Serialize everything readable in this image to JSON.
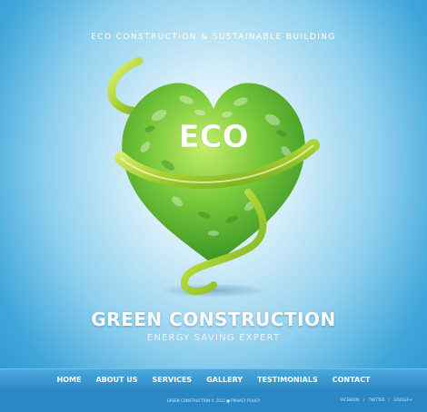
{
  "header": {
    "tagline": "ECO CONSTRUCTION & SUSTAINABLE BUILDING"
  },
  "hero": {
    "badge_text": "ECO"
  },
  "headline": {
    "title": "GREEN CONSTRUCTION",
    "subtitle": "ENERGY SAVING EXPERT"
  },
  "nav": {
    "items": [
      {
        "label": "HOME"
      },
      {
        "label": "ABOUT US"
      },
      {
        "label": "SERVICES"
      },
      {
        "label": "GALLERY"
      },
      {
        "label": "TESTIMONIALS"
      },
      {
        "label": "CONTACT"
      }
    ]
  },
  "footer": {
    "copyright": "GREEN CONSTRUCTION © 2012 ■",
    "privacy": "PRIVACY POLICY",
    "social": {
      "facebook": "FACEBOOK",
      "twitter": "TWITTER",
      "google": "GOOGLE+",
      "separator": "/"
    }
  },
  "colors": {
    "sky_blue": "#3fa6da",
    "nav_blue": "#2f8cc6",
    "leaf_green": "#6cc42f",
    "ribbon_green": "#b9dc3c"
  }
}
